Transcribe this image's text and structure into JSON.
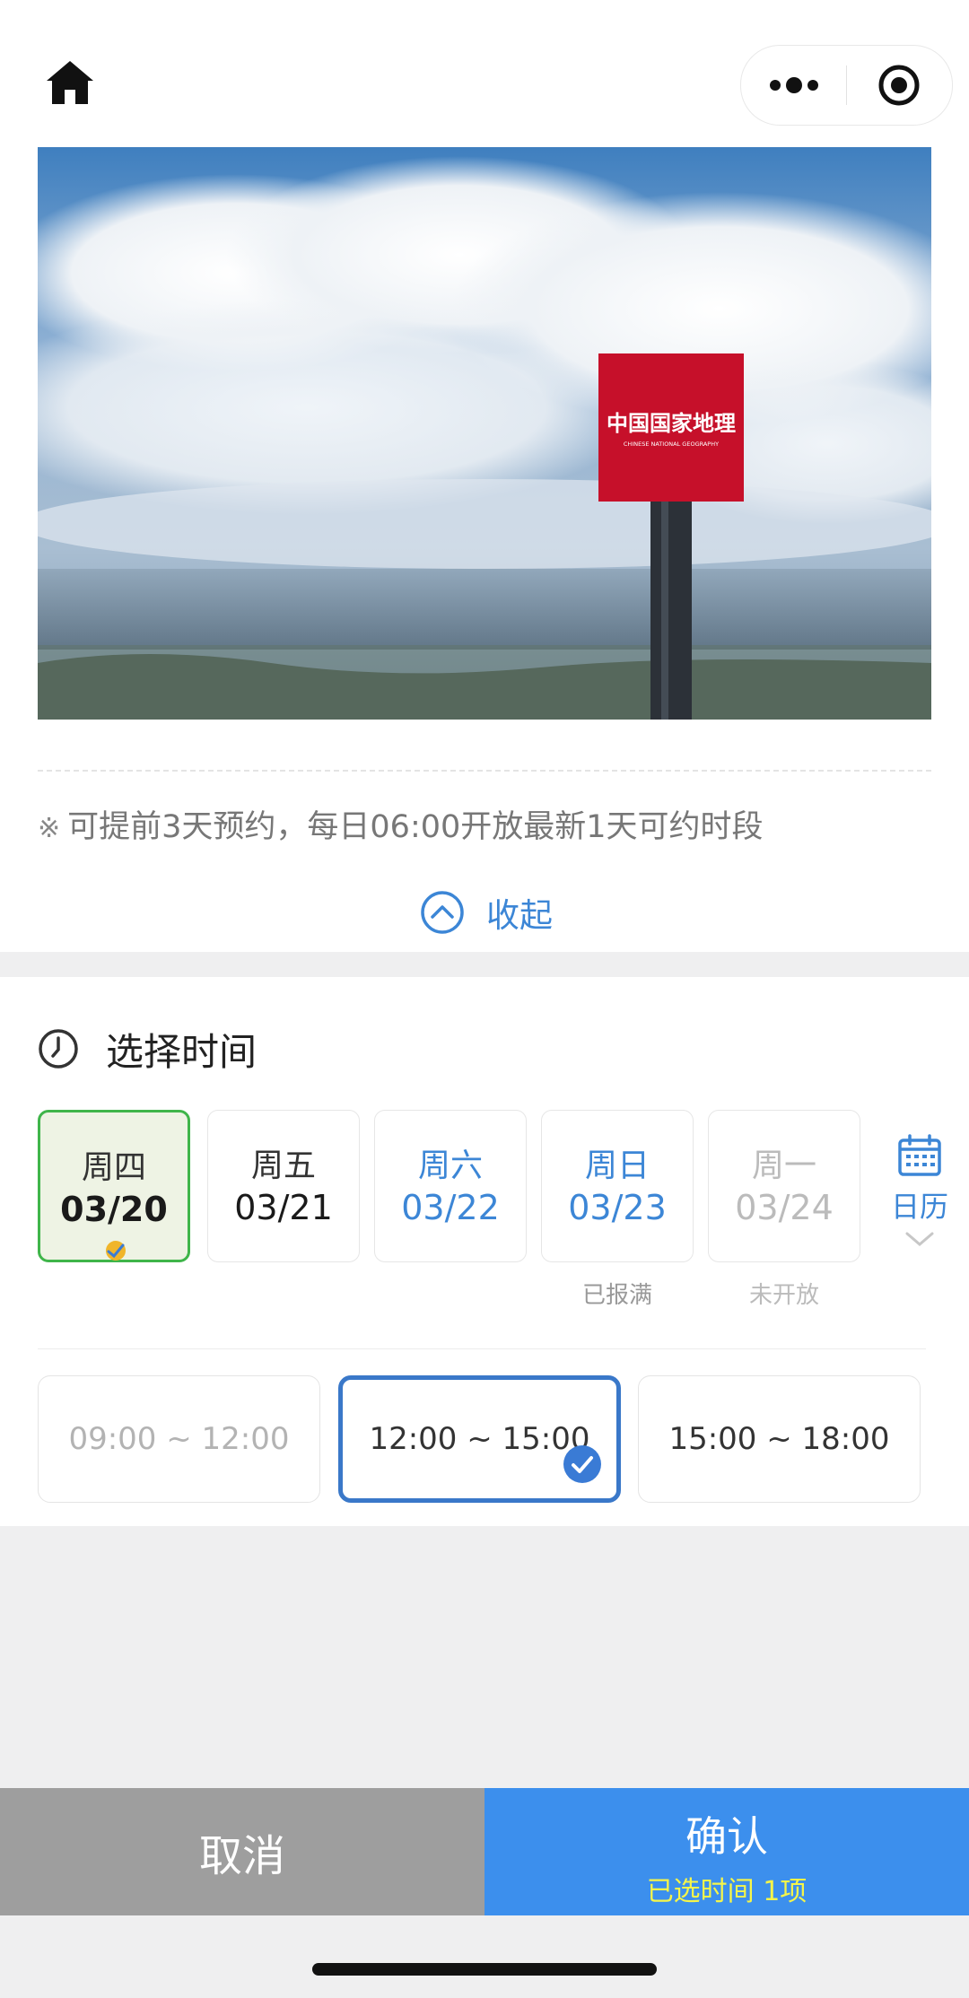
{
  "notice": {
    "mark": "※",
    "text": "可提前3天预约，每日06:00开放最新1天可约时段"
  },
  "collapse_label": "收起",
  "hero": {
    "sign_title": "中国国家地理",
    "sign_subtitle": "CHINESE NATIONAL GEOGRAPHY"
  },
  "select_time": {
    "title": "选择时间",
    "days": [
      {
        "weekday": "周四",
        "date": "03/20",
        "state": "selected",
        "note": ""
      },
      {
        "weekday": "周五",
        "date": "03/21",
        "state": "available",
        "note": ""
      },
      {
        "weekday": "周六",
        "date": "03/22",
        "state": "available",
        "note": ""
      },
      {
        "weekday": "周日",
        "date": "03/23",
        "state": "full",
        "note": "已报满"
      },
      {
        "weekday": "周一",
        "date": "03/24",
        "state": "not-open",
        "note": "未开放"
      }
    ],
    "calendar_label": "日历",
    "slots": [
      {
        "label": "09:00 ~ 12:00",
        "state": "disabled"
      },
      {
        "label": "12:00 ~ 15:00",
        "state": "selected"
      },
      {
        "label": "15:00 ~ 18:00",
        "state": "available"
      }
    ]
  },
  "footer": {
    "cancel_label": "取消",
    "confirm_label": "确认",
    "confirm_sub": "已选时间 1项"
  },
  "colors": {
    "accent": "#3c86d6",
    "confirm_bg": "#3c8fed",
    "cancel_bg": "#9e9e9e",
    "selected_day_border": "#3fb54a",
    "sub_text": "#f5f54a"
  }
}
